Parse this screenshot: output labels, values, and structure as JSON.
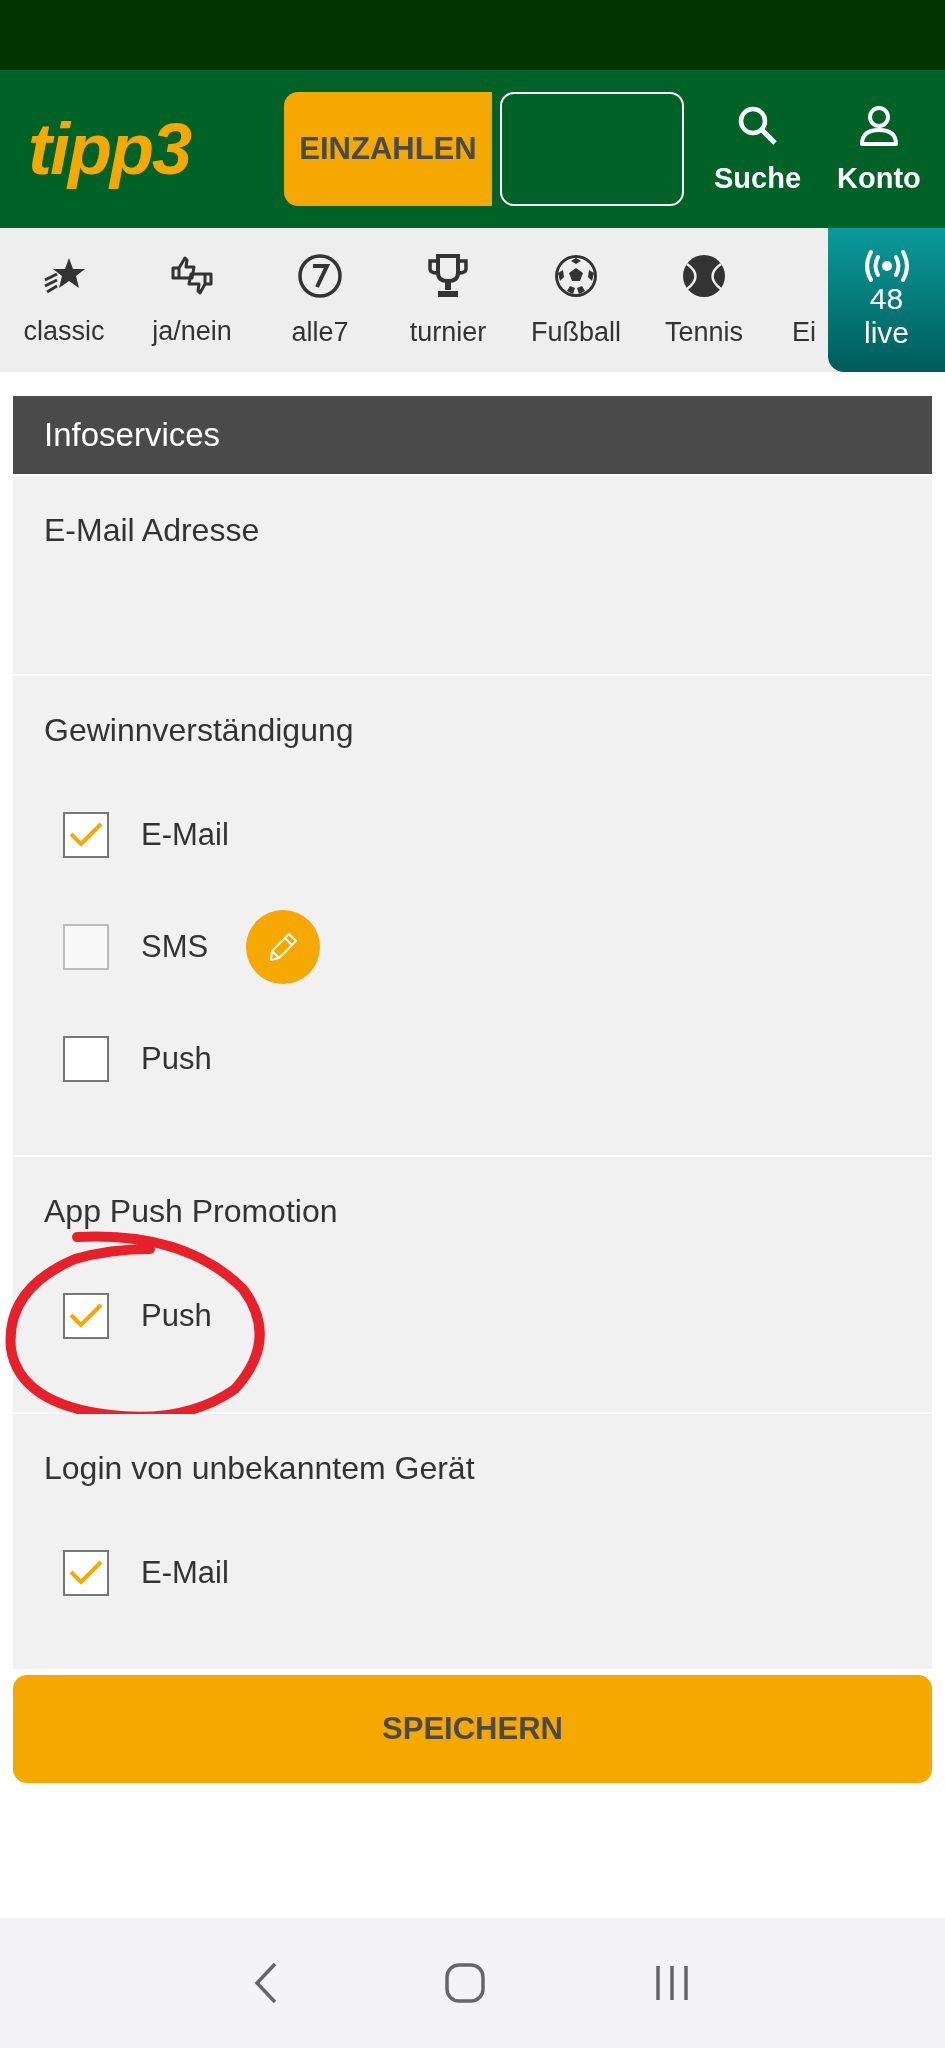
{
  "header": {
    "logo": "tipp3",
    "deposit_button": "EINZAHLEN",
    "actions": [
      {
        "label": "Suche",
        "kind": "search"
      },
      {
        "label": "Konto",
        "kind": "account"
      }
    ]
  },
  "nav": {
    "items": [
      {
        "label": "classic",
        "kind": "star"
      },
      {
        "label": "ja/nein",
        "kind": "thumbs"
      },
      {
        "label": "alle7",
        "kind": "seven"
      },
      {
        "label": "turnier",
        "kind": "trophy"
      },
      {
        "label": "Fußball",
        "kind": "football"
      },
      {
        "label": "Tennis",
        "kind": "tennis"
      },
      {
        "label": "Ei",
        "kind": "none"
      }
    ],
    "live": {
      "count": "48",
      "label": "live"
    }
  },
  "section_title": "Infoservices",
  "groups": [
    {
      "title": "E-Mail Adresse"
    },
    {
      "title": "Gewinnverständigung",
      "options": [
        {
          "label": "E-Mail",
          "checked": true,
          "disabled": false,
          "editable": false
        },
        {
          "label": "SMS",
          "checked": false,
          "disabled": true,
          "editable": true
        },
        {
          "label": "Push",
          "checked": false,
          "disabled": false,
          "editable": false
        }
      ]
    },
    {
      "title": "App Push Promotion",
      "annotated": true,
      "options": [
        {
          "label": "Push",
          "checked": true,
          "disabled": false,
          "editable": false
        }
      ]
    },
    {
      "title": "Login von unbekanntem Gerät",
      "options": [
        {
          "label": "E-Mail",
          "checked": true,
          "disabled": false,
          "editable": false
        }
      ]
    }
  ],
  "save_button": "SPEICHERN"
}
